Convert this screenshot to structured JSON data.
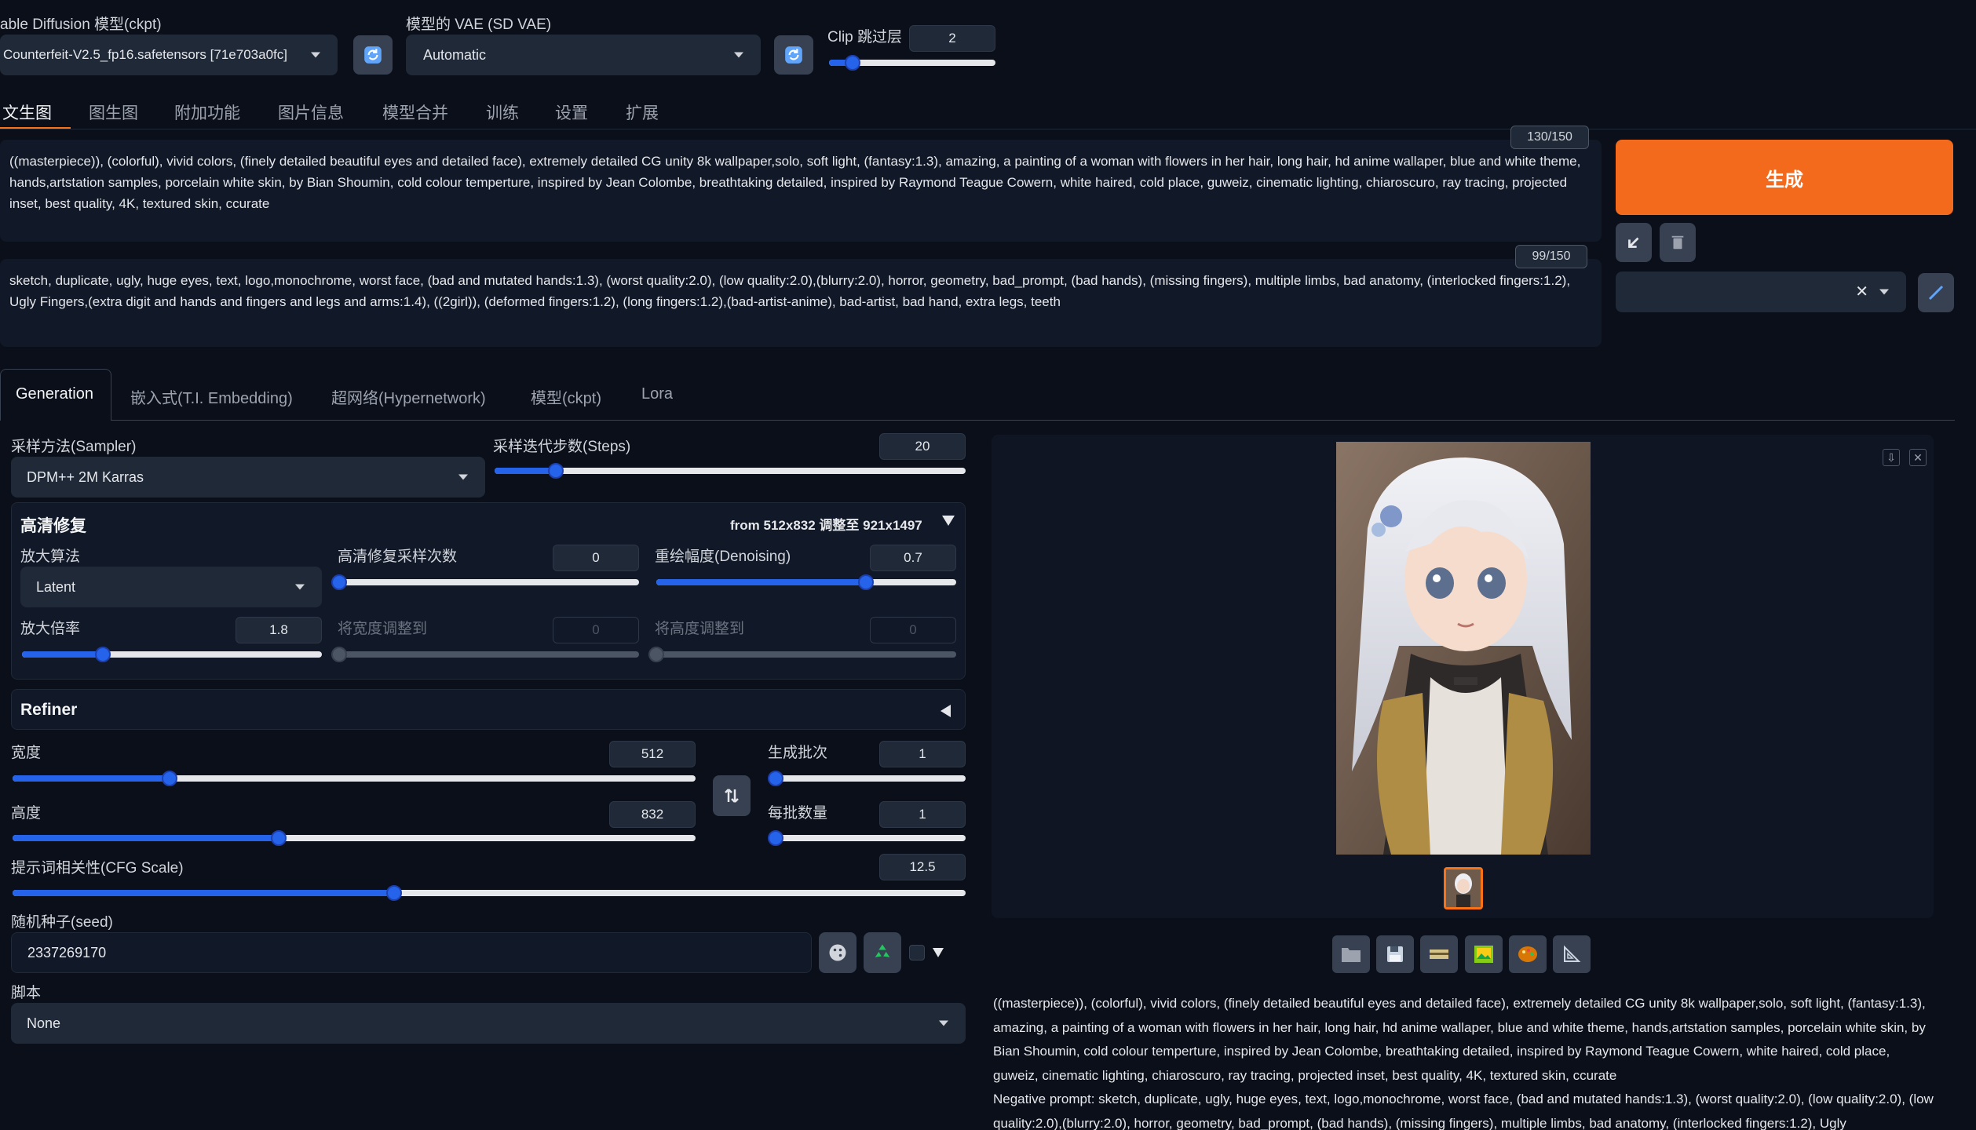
{
  "header": {
    "model_label": "able Diffusion 模型(ckpt)",
    "model_value": "Counterfeit-V2.5_fp16.safetensors [71e703a0fc]",
    "vae_label": "模型的 VAE (SD VAE)",
    "vae_value": "Automatic",
    "clip_label": "Clip 跳过层",
    "clip_value": "2",
    "clip_level": 0.14
  },
  "tabs": [
    "文生图",
    "图生图",
    "附加功能",
    "图片信息",
    "模型合并",
    "训练",
    "设置",
    "扩展"
  ],
  "prompt": {
    "text": "((masterpiece)), (colorful), vivid colors, (finely detailed beautiful eyes and detailed face), extremely detailed CG unity 8k wallpaper,solo, soft light, (fantasy:1.3), amazing, a painting of a woman with flowers in her hair, long hair, hd anime wallaper, blue and white theme, hands,artstation samples, porcelain white skin, by Bian Shoumin, cold colour temperture, inspired by Jean Colombe, breathtaking detailed, inspired by Raymond Teague Cowern, white haired, cold place, guweiz, cinematic lighting, chiaroscuro, ray tracing, projected inset, best quality, 4K, textured skin, ccurate",
    "counter": "130/150"
  },
  "negative": {
    "text": "sketch, duplicate, ugly, huge eyes, text, logo,monochrome, worst face, (bad and mutated hands:1.3), (worst quality:2.0), (low quality:2.0),(blurry:2.0), horror, geometry, bad_prompt, (bad hands), (missing fingers), multiple limbs, bad anatomy, (interlocked fingers:1.2), Ugly Fingers,(extra digit and hands and fingers and legs and arms:1.4), ((2girl)), (deformed fingers:1.2), (long fingers:1.2),(bad-artist-anime), bad-artist, bad hand, extra legs, teeth",
    "counter": "99/150"
  },
  "generate_label": "生成",
  "subtabs": [
    "Generation",
    "嵌入式(T.I. Embedding)",
    "超网络(Hypernetwork)",
    "模型(ckpt)",
    "Lora"
  ],
  "sampler": {
    "label": "采样方法(Sampler)",
    "value": "DPM++ 2M Karras"
  },
  "steps": {
    "label": "采样迭代步数(Steps)",
    "value": "20",
    "level": 0.13
  },
  "hires": {
    "title": "高清修复",
    "summary": "from 512x832  调整至 921x1497",
    "upscaler_label": "放大算法",
    "upscaler_value": "Latent",
    "hires_steps_label": "高清修复采样次数",
    "hires_steps_value": "0",
    "hires_steps_level": 0.0,
    "denoise_label": "重绘幅度(Denoising)",
    "denoise_value": "0.7",
    "denoise_level": 0.7,
    "scale_label": "放大倍率",
    "scale_value": "1.8",
    "scale_level": 0.27,
    "resize_w_label": "将宽度调整到",
    "resize_w_value": "0",
    "resize_h_label": "将高度调整到",
    "resize_h_value": "0"
  },
  "refiner_label": "Refiner",
  "width": {
    "label": "宽度",
    "value": "512",
    "level": 0.23
  },
  "height": {
    "label": "高度",
    "value": "832",
    "level": 0.39
  },
  "batch_count": {
    "label": "生成批次",
    "value": "1",
    "level": 0.0
  },
  "batch_size": {
    "label": "每批数量",
    "value": "1",
    "level": 0.0
  },
  "cfg": {
    "label": "提示词相关性(CFG Scale)",
    "value": "12.5",
    "level": 0.4
  },
  "seed": {
    "label": "随机种子(seed)",
    "value": "2337269170"
  },
  "script": {
    "label": "脚本",
    "value": "None"
  },
  "output_text": "((masterpiece)), (colorful), vivid colors, (finely detailed beautiful eyes and detailed face), extremely detailed CG unity 8k wallpaper,solo, soft light, (fantasy:1.3), amazing, a painting of a woman with flowers in her hair, long hair, hd anime wallaper, blue and white theme, hands,artstation samples, porcelain white skin, by Bian Shoumin, cold colour temperture, inspired by Jean Colombe, breathtaking detailed, inspired by Raymond Teague Cowern, white haired, cold place, guweiz, cinematic lighting, chiaroscuro, ray tracing, projected inset, best quality, 4K, textured skin, ccurate",
  "output_negative": "Negative prompt: sketch, duplicate, ugly, huge eyes, text, logo,monochrome, worst face, (bad and mutated hands:1.3), (worst quality:2.0), (low quality:2.0), (low quality:2.0),(blurry:2.0), horror, geometry, bad_prompt, (bad hands), (missing fingers), multiple limbs, bad anatomy, (interlocked fingers:1.2), Ugly",
  "colors": {
    "accent": "#f97316",
    "slider": "#2563eb",
    "bg": "#0b0f19"
  }
}
